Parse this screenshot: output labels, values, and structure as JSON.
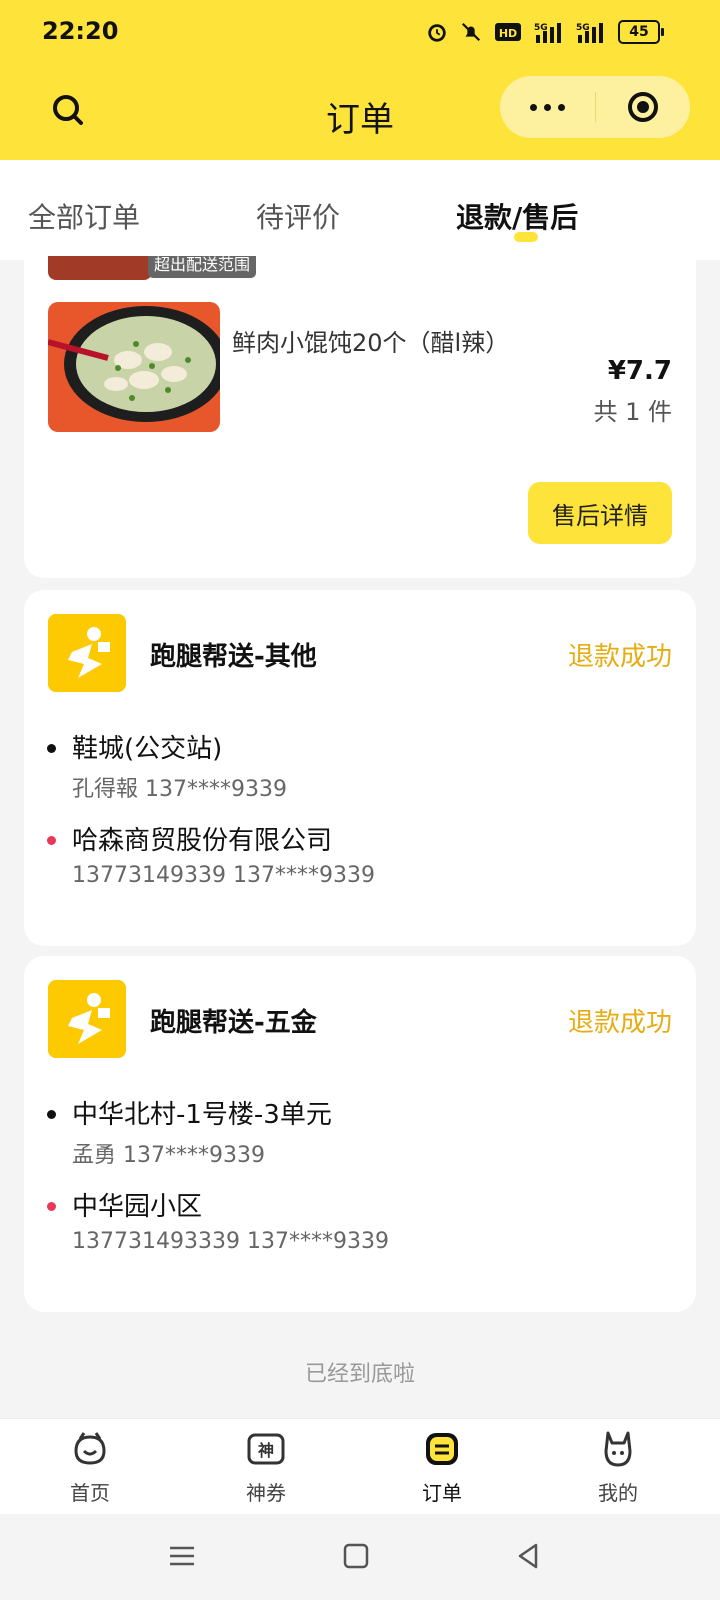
{
  "status_bar": {
    "time": "22:20",
    "battery": "45",
    "network": "5G"
  },
  "header": {
    "title": "订单"
  },
  "tabs": [
    {
      "label": "全部订单"
    },
    {
      "label": "待评价"
    },
    {
      "label": "退款/售后"
    }
  ],
  "partial_order": {
    "tag": "超出配送范围"
  },
  "food_order": {
    "item_name": "鲜肉小馄饨20个（醋l辣）",
    "price": "¥7.7",
    "quantity": "共 1 件",
    "button_label": "售后详情"
  },
  "errand_orders": [
    {
      "service": "跑腿帮送-其他",
      "status": "退款成功",
      "pickup": {
        "place": "鞋城(公交站)",
        "contact": "孔得報 137****9339"
      },
      "dropoff": {
        "place": "哈森商贸股份有限公司",
        "contact": "13773149339 137****9339"
      }
    },
    {
      "service": "跑腿帮送-五金",
      "status": "退款成功",
      "pickup": {
        "place": "中华北村-1号楼-3单元",
        "contact": "孟勇 137****9339"
      },
      "dropoff": {
        "place": "中华园小区",
        "contact": "137731493339 137****9339"
      }
    }
  ],
  "end_text": "已经到底啦",
  "tabbar": [
    {
      "label": "首页",
      "icon": "home-face-icon"
    },
    {
      "label": "神券",
      "icon": "coupon-icon"
    },
    {
      "label": "订单",
      "icon": "order-icon"
    },
    {
      "label": "我的",
      "icon": "profile-icon"
    }
  ],
  "colors": {
    "brand_yellow": "#fde33a",
    "status_orange": "#e6ac12",
    "dot_red": "#e8395a"
  }
}
